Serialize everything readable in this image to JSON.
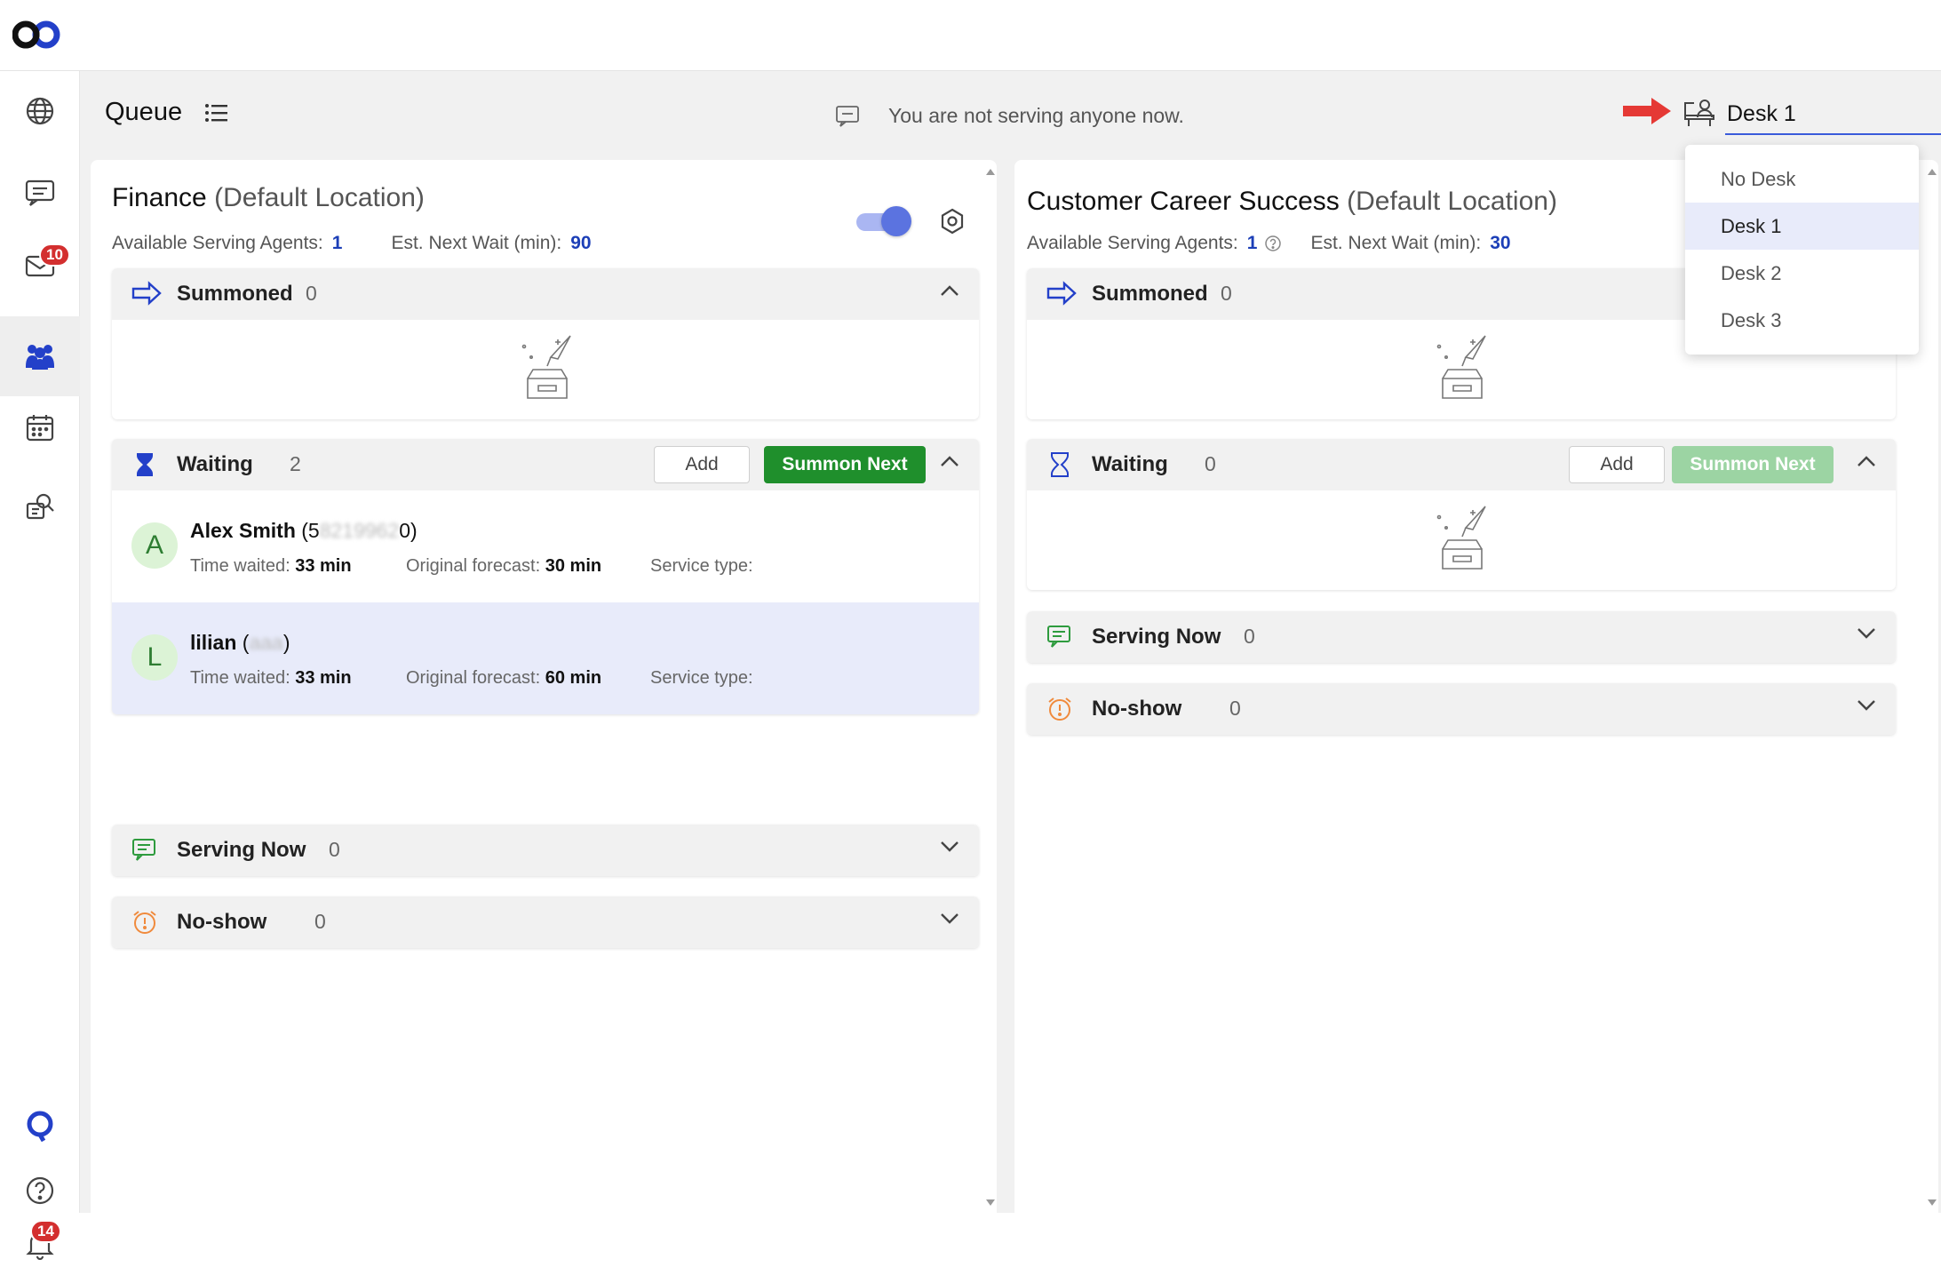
{
  "header": {
    "page_title": "Queue"
  },
  "status": {
    "text": "You are not serving anyone now."
  },
  "rail": {
    "mail_badge": "10",
    "bell_badge": "14"
  },
  "desk": {
    "value": "Desk 1",
    "options": [
      "No Desk",
      "Desk 1",
      "Desk 2",
      "Desk 3"
    ],
    "selected": "Desk 1"
  },
  "queues": [
    {
      "name": "Finance",
      "location": "(Default Location)",
      "agents_label": "Available Serving Agents:",
      "agents": "1",
      "wait_label": "Est. Next Wait (min):",
      "wait": "90",
      "summoned": {
        "label": "Summoned",
        "count": "0"
      },
      "waiting": {
        "label": "Waiting",
        "count": "2",
        "add_label": "Add",
        "summon_label": "Summon Next",
        "people": [
          {
            "initial": "A",
            "name": "Alex Smith",
            "id_open": " (5",
            "id_masked": "8219962",
            "id_close": "0)",
            "time_label": "Time waited:",
            "time": "33 min",
            "forecast_label": "Original forecast:",
            "forecast": "30 min",
            "service_label": "Service type:"
          },
          {
            "initial": "L",
            "name": "lilian",
            "id_open": " (",
            "id_masked": "aaa",
            "id_close": ")",
            "time_label": "Time waited:",
            "time": "33 min",
            "forecast_label": "Original forecast:",
            "forecast": "60 min",
            "service_label": "Service type:"
          }
        ]
      },
      "serving": {
        "label": "Serving Now",
        "count": "0"
      },
      "noshow": {
        "label": "No-show",
        "count": "0"
      }
    },
    {
      "name": "Customer Career Success",
      "location": "(Default Location)",
      "agents_label": "Available Serving Agents:",
      "agents": "1",
      "wait_label": "Est. Next Wait (min):",
      "wait": "30",
      "summoned": {
        "label": "Summoned",
        "count": "0"
      },
      "waiting": {
        "label": "Waiting",
        "count": "0",
        "add_label": "Add",
        "summon_label": "Summon Next"
      },
      "serving": {
        "label": "Serving Now",
        "count": "0"
      },
      "noshow": {
        "label": "No-show",
        "count": "0"
      }
    }
  ],
  "colors": {
    "accent": "#3b5bdb",
    "summon_green": "#1f8f2c",
    "badge_red": "#d32f2f",
    "arrow_red": "#e53935"
  }
}
